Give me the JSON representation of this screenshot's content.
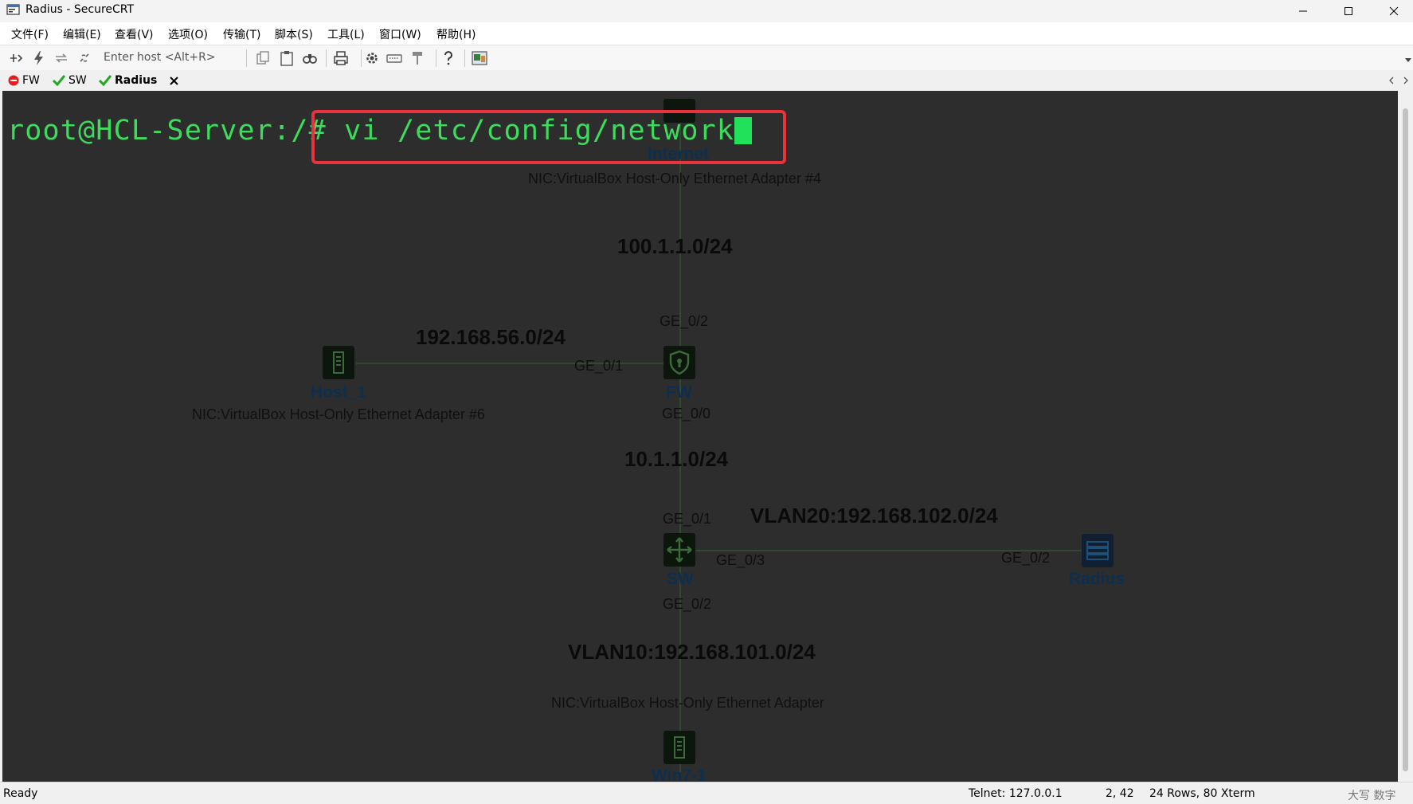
{
  "window": {
    "title": "Radius - SecureCRT"
  },
  "menu": [
    "文件(F)",
    "编辑(E)",
    "查看(V)",
    "选项(O)",
    "传输(T)",
    "脚本(S)",
    "工具(L)",
    "窗口(W)",
    "帮助(H)"
  ],
  "toolbar": {
    "host_placeholder": "Enter host <Alt+R>"
  },
  "tabs": [
    {
      "label": "FW",
      "status": "disconnected"
    },
    {
      "label": "SW",
      "status": "connected"
    },
    {
      "label": "Radius",
      "status": "connected",
      "active": true
    }
  ],
  "terminal": {
    "prompt": "root@HCL-Server:/# ",
    "command": "vi /etc/config/network",
    "prompt_color": "#3ddc5c",
    "highlight_color": "#e8323c"
  },
  "topology": {
    "networks": {
      "internet_link": "100.1.1.0/24",
      "host_link": "192.168.56.0/24",
      "fw_sw_link": "10.1.1.0/24",
      "vlan20": "VLAN20:192.168.102.0/24",
      "vlan10": "VLAN10:192.168.101.0/24"
    },
    "ports": {
      "fw_top": "GE_0/2",
      "fw_left": "GE_0/1",
      "fw_bottom": "GE_0/0",
      "sw_top": "GE_0/1",
      "sw_right": "GE_0/3",
      "sw_bottom": "GE_0/2",
      "radius_left": "GE_0/2"
    },
    "devices": {
      "internet": "Internet",
      "host1": "Host_1",
      "fw": "FW",
      "sw": "SW",
      "radius": "Radius",
      "win7": "Win7-1"
    },
    "nics": {
      "internet": "NIC:VirtualBox Host-Only Ethernet Adapter #4",
      "host1": "NIC:VirtualBox Host-Only Ethernet Adapter #6",
      "win7": "NIC:VirtualBox Host-Only Ethernet Adapter"
    }
  },
  "status": {
    "state": "Ready",
    "connection": "Telnet: 127.0.0.1",
    "cursor_pos": "2,  42",
    "size": "24 Rows, 80 Xterm",
    "ime": "大写 数字"
  }
}
